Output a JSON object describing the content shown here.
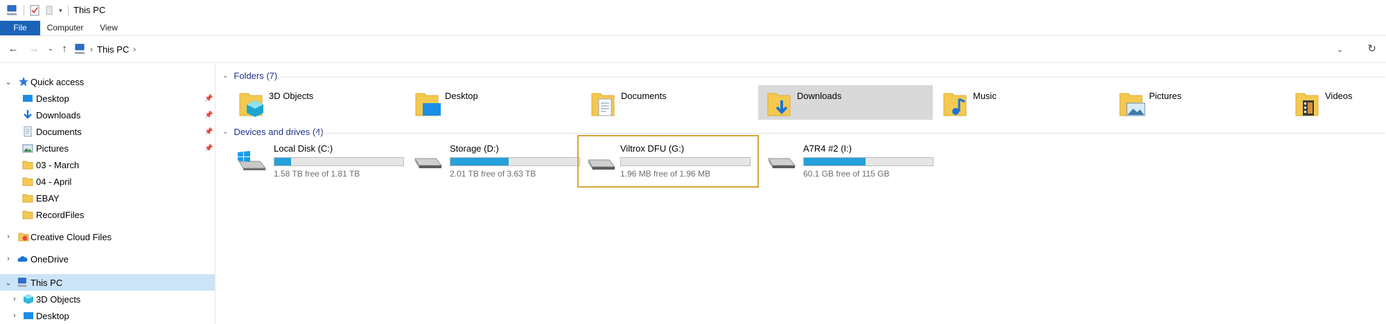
{
  "window": {
    "title": "This PC"
  },
  "ribbon": {
    "tabs": [
      "File",
      "Computer",
      "View"
    ]
  },
  "address": {
    "segments": [
      "This PC"
    ]
  },
  "sidebar": {
    "quick_access": {
      "label": "Quick access",
      "items": [
        {
          "label": "Desktop",
          "pinned": true,
          "icon": "desktop-icon"
        },
        {
          "label": "Downloads",
          "pinned": true,
          "icon": "downloads-icon"
        },
        {
          "label": "Documents",
          "pinned": true,
          "icon": "documents-icon"
        },
        {
          "label": "Pictures",
          "pinned": true,
          "icon": "pictures-icon"
        },
        {
          "label": "03 - March",
          "pinned": false,
          "icon": "folder-icon"
        },
        {
          "label": "04 - April",
          "pinned": false,
          "icon": "folder-icon"
        },
        {
          "label": "EBAY",
          "pinned": false,
          "icon": "folder-icon"
        },
        {
          "label": "RecordFiles",
          "pinned": false,
          "icon": "folder-icon"
        }
      ]
    },
    "creative_cloud": "Creative Cloud Files",
    "onedrive": "OneDrive",
    "this_pc": "This PC",
    "this_pc_children": [
      "3D Objects",
      "Desktop"
    ]
  },
  "content": {
    "folders_header": "Folders (7)",
    "folders": [
      {
        "name": "3D Objects",
        "icon": "3d-objects-folder-icon"
      },
      {
        "name": "Desktop",
        "icon": "desktop-folder-icon"
      },
      {
        "name": "Documents",
        "icon": "documents-folder-icon"
      },
      {
        "name": "Downloads",
        "icon": "downloads-folder-icon",
        "selected": true
      },
      {
        "name": "Music",
        "icon": "music-folder-icon"
      },
      {
        "name": "Pictures",
        "icon": "pictures-folder-icon"
      },
      {
        "name": "Videos",
        "icon": "videos-folder-icon"
      }
    ],
    "drives_header": "Devices and drives (4)",
    "drives": [
      {
        "name": "Local Disk (C:)",
        "free": "1.58 TB free of 1.81 TB",
        "used_fraction": 0.13,
        "icon": "windows-drive-icon"
      },
      {
        "name": "Storage (D:)",
        "free": "2.01 TB free of 3.63 TB",
        "used_fraction": 0.45,
        "icon": "hard-drive-icon"
      },
      {
        "name": "Viltrox DFU (G:)",
        "free": "1.96 MB free of 1.96 MB",
        "used_fraction": 0.0,
        "icon": "hard-drive-icon",
        "focused": true
      },
      {
        "name": "A7R4 #2 (I:)",
        "free": "60.1 GB free of 115 GB",
        "used_fraction": 0.48,
        "icon": "hard-drive-icon"
      }
    ]
  },
  "colors": {
    "accent": "#1a63b8",
    "selection": "#cce4f7",
    "focus_border": "#d7a43a",
    "bar_fill": "#26a0da"
  }
}
